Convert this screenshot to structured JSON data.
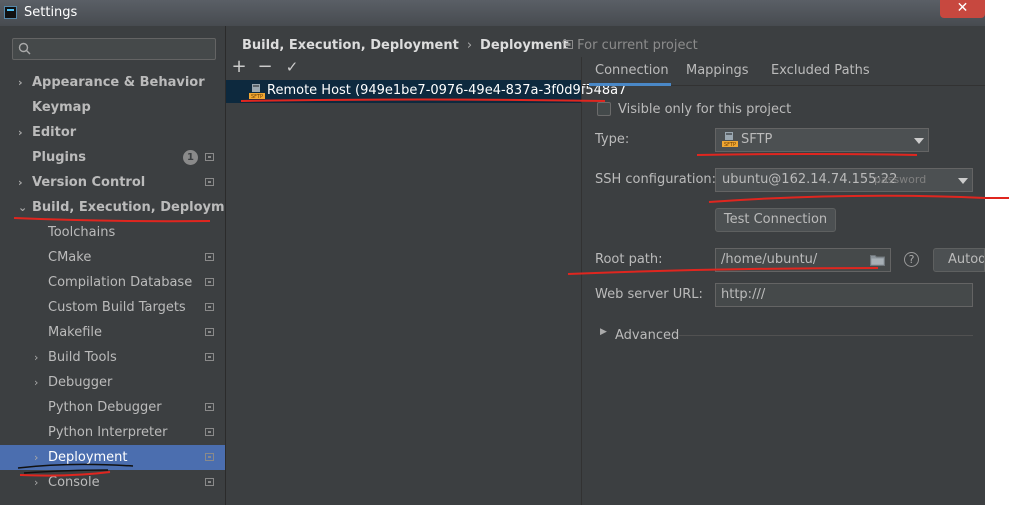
{
  "window": {
    "title": "Settings",
    "close_glyph": "✕"
  },
  "sidebar": {
    "search_placeholder": "",
    "items": [
      {
        "label": "Appearance & Behavior",
        "arrow": "›",
        "bold": true,
        "project": false
      },
      {
        "label": "Keymap",
        "arrow": "",
        "bold": true,
        "project": false
      },
      {
        "label": "Editor",
        "arrow": "›",
        "bold": true,
        "project": false
      },
      {
        "label": "Plugins",
        "arrow": "",
        "bold": true,
        "project": true,
        "badge": "1"
      },
      {
        "label": "Version Control",
        "arrow": "›",
        "bold": true,
        "project": true
      },
      {
        "label": "Build, Execution, Deployment",
        "arrow": "⌄",
        "bold": true,
        "project": false
      },
      {
        "label": "Toolchains",
        "arrow": "",
        "bold": false,
        "project": false
      },
      {
        "label": "CMake",
        "arrow": "",
        "bold": false,
        "project": true
      },
      {
        "label": "Compilation Database",
        "arrow": "",
        "bold": false,
        "project": true
      },
      {
        "label": "Custom Build Targets",
        "arrow": "",
        "bold": false,
        "project": true
      },
      {
        "label": "Makefile",
        "arrow": "",
        "bold": false,
        "project": true
      },
      {
        "label": "Build Tools",
        "arrow": "›",
        "bold": false,
        "project": true
      },
      {
        "label": "Debugger",
        "arrow": "›",
        "bold": false,
        "project": false
      },
      {
        "label": "Python Debugger",
        "arrow": "",
        "bold": false,
        "project": true
      },
      {
        "label": "Python Interpreter",
        "arrow": "",
        "bold": false,
        "project": true
      },
      {
        "label": "Deployment",
        "arrow": "›",
        "bold": false,
        "project": true,
        "selected": true
      },
      {
        "label": "Console",
        "arrow": "›",
        "bold": false,
        "project": true
      }
    ]
  },
  "breadcrumb": {
    "parent": "Build, Execution, Deployment",
    "separator": "›",
    "current": "Deployment"
  },
  "scope": {
    "label": "For current project",
    "icon": "project-scope-icon"
  },
  "server_toolbar": {
    "add": "+",
    "remove": "−",
    "apply": "✓"
  },
  "servers": [
    {
      "name": "Remote Host (949e1be7-0976-49e4-837a-3f0d9f548a7",
      "icon": "sftp-icon"
    }
  ],
  "tabs": [
    {
      "label": "Connection",
      "active": true
    },
    {
      "label": "Mappings",
      "active": false
    },
    {
      "label": "Excluded Paths",
      "active": false
    }
  ],
  "form": {
    "visible_only_label": "Visible only for this project",
    "visible_only_checked": false,
    "type_label": "Type:",
    "type_value": "SFTP",
    "ssh_label": "SSH configuration:",
    "ssh_value": "ubuntu@162.14.74.155:22",
    "ssh_hint": "password",
    "test_button": "Test Connection",
    "root_label": "Root path:",
    "root_value": "/home/ubuntu/",
    "help_glyph": "?",
    "autodetect_button": "Autodetect",
    "web_label": "Web server URL:",
    "web_value": "http:///",
    "advanced_label": "Advanced"
  },
  "colors": {
    "background": "#3c3f41",
    "selection": "#4b6eaf",
    "annotation": "#e0261f"
  }
}
